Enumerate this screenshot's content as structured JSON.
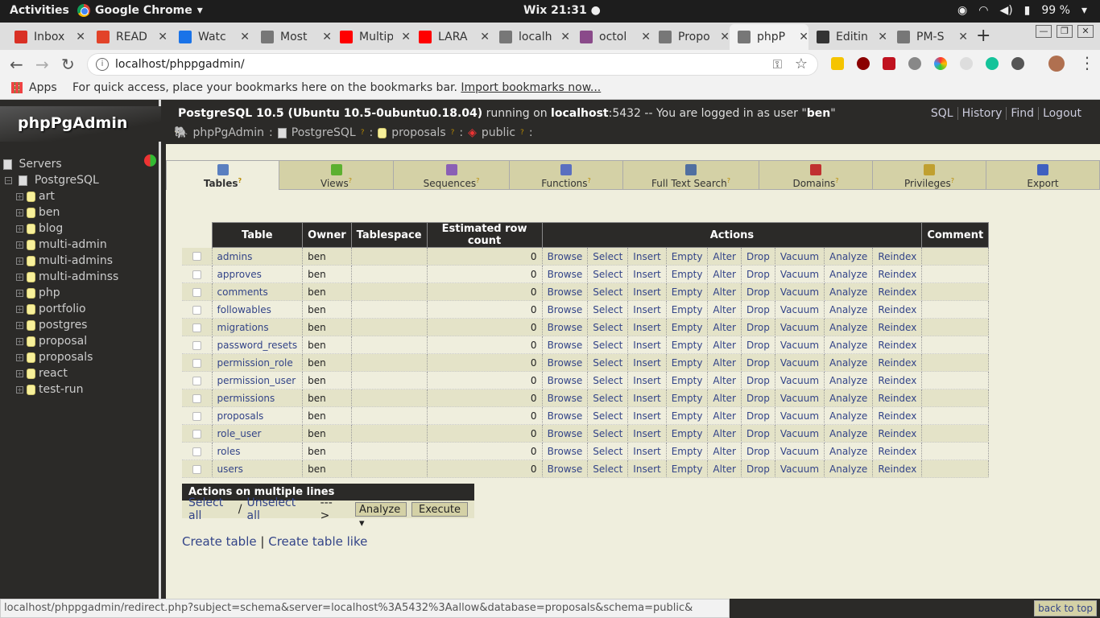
{
  "system": {
    "activities": "Activities",
    "app_name": "Google Chrome",
    "clock": "Wix 21:31 ●",
    "battery": "99 %"
  },
  "browser": {
    "tabs": [
      {
        "label": "Inbox",
        "icon_color": "#d93025"
      },
      {
        "label": "READ",
        "icon_color": "#e24329"
      },
      {
        "label": "Watc",
        "icon_color": "#1a73e8"
      },
      {
        "label": "Most",
        "icon_color": "#777777"
      },
      {
        "label": "Multip",
        "icon_color": "#ff0000"
      },
      {
        "label": "LARA",
        "icon_color": "#ff0000"
      },
      {
        "label": "localh",
        "icon_color": "#777777"
      },
      {
        "label": "octol",
        "icon_color": "#8a4a8a"
      },
      {
        "label": "Propo",
        "icon_color": "#777777"
      },
      {
        "label": "phpP",
        "icon_color": "#777777",
        "active": true
      },
      {
        "label": "Editin",
        "icon_color": "#333333"
      },
      {
        "label": "PM-S",
        "icon_color": "#777777"
      }
    ],
    "url": "localhost/phppgadmin/",
    "bookmarks_apps": "Apps",
    "bookmarks_message": "For quick access, place your bookmarks here on the bookmarks bar.",
    "bookmarks_link": "Import bookmarks now...",
    "status_url": "localhost/phppgadmin/redirect.php?subject=schema&server=localhost%3A5432%3Aallow&database=proposals&schema=public&"
  },
  "sidebar": {
    "logo": "phpPgAdmin",
    "servers": "Servers",
    "server_name": "PostgreSQL",
    "databases": [
      "art",
      "ben",
      "blog",
      "multi-admin",
      "multi-admins",
      "multi-adminss",
      "php",
      "portfolio",
      "postgres",
      "proposal",
      "proposals",
      "react",
      "test-run"
    ]
  },
  "header": {
    "server_version": "PostgreSQL 10.5 (Ubuntu 10.5-0ubuntu0.18.04)",
    "running_on": "running on",
    "host": "localhost",
    "port_text": ":5432 -- You are logged in as user \"",
    "user": "ben",
    "quote_end": "\"",
    "links": {
      "sql": "SQL",
      "history": "History",
      "find": "Find",
      "logout": "Logout"
    },
    "breadcrumb": {
      "root": "phpPgAdmin",
      "server": "PostgreSQL",
      "database": "proposals",
      "schema": "public",
      "q": "?",
      "sep": ":"
    }
  },
  "tabs": [
    {
      "label": "Tables",
      "q": "?",
      "color": "#5a7fc0"
    },
    {
      "label": "Views",
      "q": "?",
      "color": "#5cb030"
    },
    {
      "label": "Sequences",
      "q": "?",
      "color": "#8a5fb5"
    },
    {
      "label": "Functions",
      "q": "?",
      "color": "#5a6fc0"
    },
    {
      "label": "Full Text Search",
      "q": "?",
      "color": "#506fa0"
    },
    {
      "label": "Domains",
      "q": "?",
      "color": "#c03030"
    },
    {
      "label": "Privileges",
      "q": "?",
      "color": "#c0a030"
    },
    {
      "label": "Export",
      "q": "",
      "color": "#4060c0"
    }
  ],
  "table": {
    "headers": [
      "Table",
      "Owner",
      "Tablespace",
      "Estimated row count",
      "Actions",
      "Comment"
    ],
    "actions": [
      "Browse",
      "Select",
      "Insert",
      "Empty",
      "Alter",
      "Drop",
      "Vacuum",
      "Analyze",
      "Reindex"
    ],
    "rows": [
      {
        "name": "admins",
        "owner": "ben",
        "tablespace": "",
        "count": "0",
        "comment": ""
      },
      {
        "name": "approves",
        "owner": "ben",
        "tablespace": "",
        "count": "0",
        "comment": ""
      },
      {
        "name": "comments",
        "owner": "ben",
        "tablespace": "",
        "count": "0",
        "comment": ""
      },
      {
        "name": "followables",
        "owner": "ben",
        "tablespace": "",
        "count": "0",
        "comment": ""
      },
      {
        "name": "migrations",
        "owner": "ben",
        "tablespace": "",
        "count": "0",
        "comment": ""
      },
      {
        "name": "password_resets",
        "owner": "ben",
        "tablespace": "",
        "count": "0",
        "comment": ""
      },
      {
        "name": "permission_role",
        "owner": "ben",
        "tablespace": "",
        "count": "0",
        "comment": ""
      },
      {
        "name": "permission_user",
        "owner": "ben",
        "tablespace": "",
        "count": "0",
        "comment": ""
      },
      {
        "name": "permissions",
        "owner": "ben",
        "tablespace": "",
        "count": "0",
        "comment": ""
      },
      {
        "name": "proposals",
        "owner": "ben",
        "tablespace": "",
        "count": "0",
        "comment": ""
      },
      {
        "name": "role_user",
        "owner": "ben",
        "tablespace": "",
        "count": "0",
        "comment": ""
      },
      {
        "name": "roles",
        "owner": "ben",
        "tablespace": "",
        "count": "0",
        "comment": ""
      },
      {
        "name": "users",
        "owner": "ben",
        "tablespace": "",
        "count": "0",
        "comment": ""
      }
    ]
  },
  "multi": {
    "title": "Actions on multiple lines",
    "select_all": "Select all",
    "slash": "/",
    "unselect_all": "Unselect all",
    "arrow": "--->",
    "action_value": "Analyze",
    "execute": "Execute"
  },
  "create": {
    "create_table": "Create table",
    "sep": "|",
    "create_like": "Create table like"
  },
  "back_to_top": "back to top"
}
